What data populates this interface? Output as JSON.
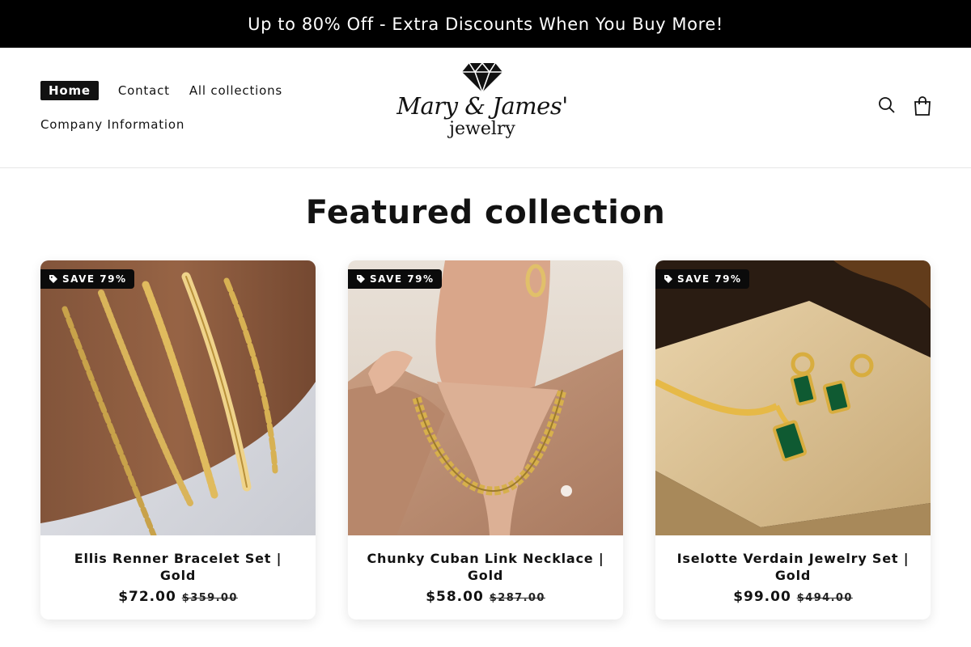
{
  "announcement": {
    "text": "Up to 80% Off - Extra Discounts When You Buy More!"
  },
  "nav": {
    "items": [
      {
        "label": "Home"
      },
      {
        "label": "Contact"
      },
      {
        "label": "All collections"
      },
      {
        "label": "Company Information"
      }
    ],
    "active": "Home"
  },
  "logo": {
    "main": "Mary & James'",
    "sub": "jewelry",
    "icon": "diamond-icon"
  },
  "header_icons": [
    "search-icon",
    "cart-icon"
  ],
  "section": {
    "title": "Featured collection"
  },
  "products": [
    {
      "badge": "SAVE 79%",
      "name": "Ellis Renner Bracelet Set | Gold",
      "price": "$72.00",
      "compare_price": "$359.00"
    },
    {
      "badge": "SAVE 79%",
      "name": "Chunky Cuban Link Necklace | Gold",
      "price": "$58.00",
      "compare_price": "$287.00"
    },
    {
      "badge": "SAVE 79%",
      "name": "Iselotte Verdain Jewelry Set | Gold",
      "price": "$99.00",
      "compare_price": "$494.00"
    }
  ],
  "colors": {
    "announcement_bg": "#000000",
    "badge_bg": "#0b0b0b",
    "text": "#121212",
    "accent_gold": "#d4a93c"
  }
}
